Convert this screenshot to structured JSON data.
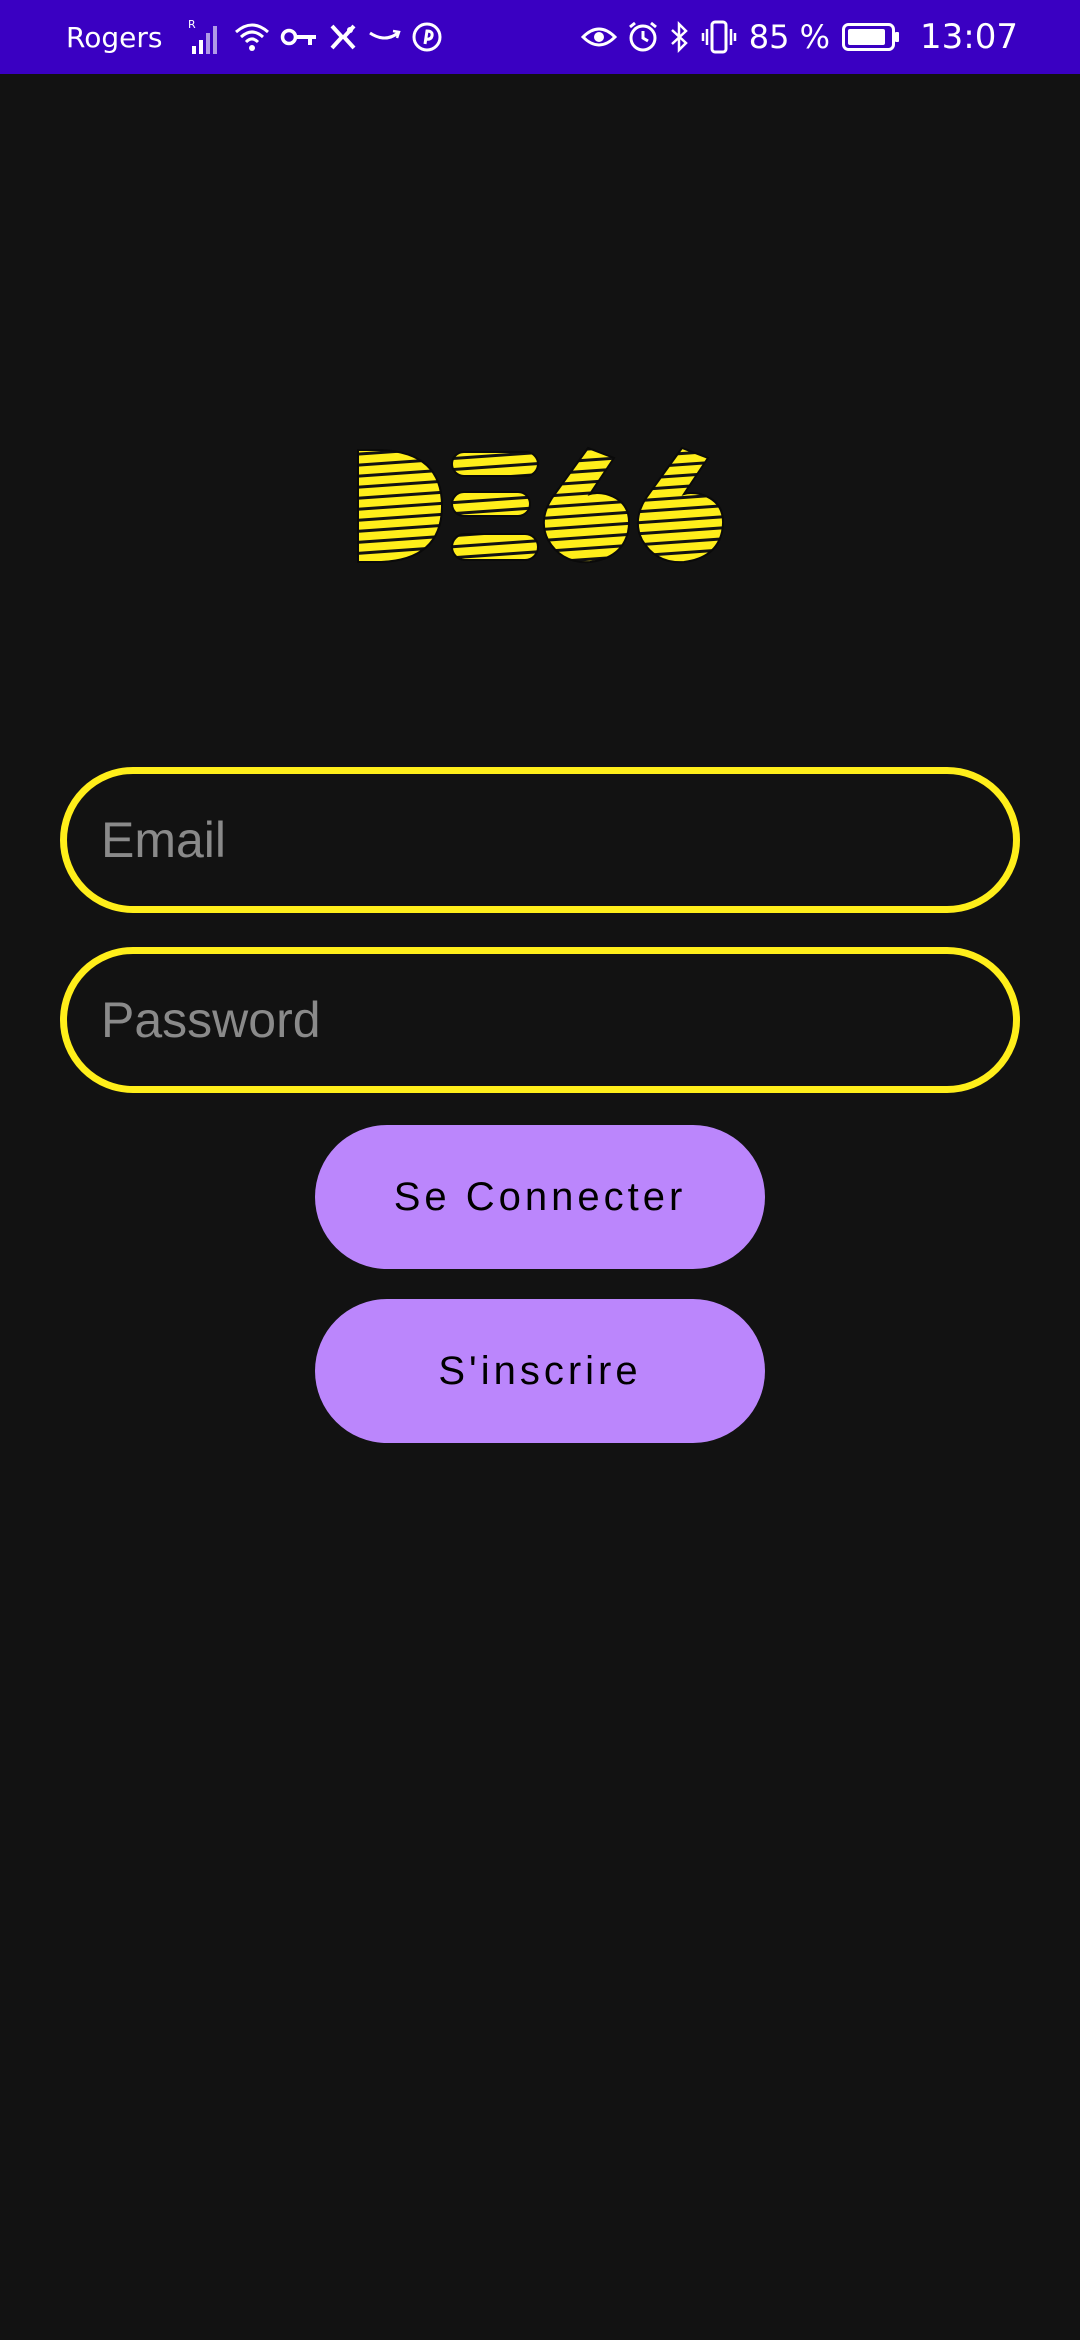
{
  "status_bar": {
    "carrier": "Rogers",
    "signal_badge": "R",
    "battery_percent": "85 %",
    "time": "13:07",
    "left_icons": [
      "signal-icon",
      "wifi-icon",
      "vpn-key-icon",
      "app-icon",
      "amazon-icon",
      "pinterest-icon"
    ],
    "right_icons": [
      "eye-icon",
      "alarm-icon",
      "bluetooth-icon",
      "vibrate-icon",
      "battery-icon"
    ]
  },
  "logo": {
    "text": "DE66",
    "color": "#ffee1a"
  },
  "form": {
    "email_placeholder": "Email",
    "password_placeholder": "Password",
    "login_label": "Se Connecter",
    "signup_label": "S'inscrire"
  },
  "colors": {
    "status_bar_bg": "#3a00c2",
    "background": "#121212",
    "field_border": "#ffee1a",
    "button_bg": "#bb86fc",
    "button_text": "#000000",
    "placeholder": "#8a8a8a"
  }
}
